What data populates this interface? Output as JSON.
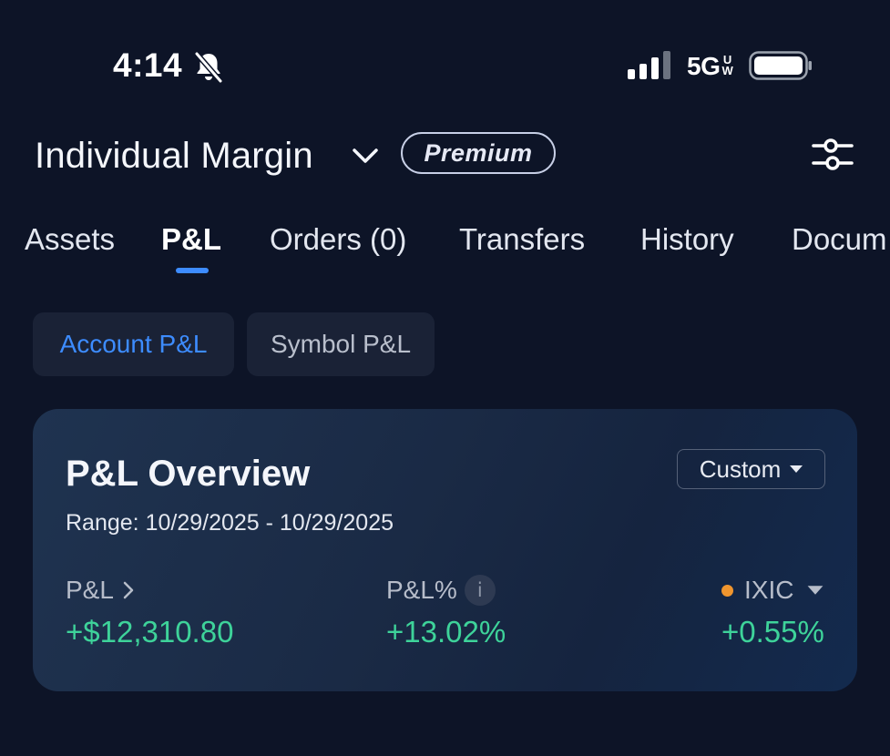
{
  "status_bar": {
    "time": "4:14",
    "network": "5G",
    "network_sup": "UW"
  },
  "header": {
    "account_name": "Individual Margin",
    "badge": "Premium"
  },
  "tabs": [
    {
      "label": "Assets"
    },
    {
      "label": "P&L"
    },
    {
      "label": "Orders (0)"
    },
    {
      "label": "Transfers"
    },
    {
      "label": "History"
    },
    {
      "label": "Docum"
    }
  ],
  "segments": [
    {
      "label": "Account P&L"
    },
    {
      "label": "Symbol P&L"
    }
  ],
  "overview": {
    "title": "P&L Overview",
    "range_select": "Custom",
    "range_text": "Range: 10/29/2025 - 10/29/2025",
    "pnl_label": "P&L",
    "pnl_value": "+$12,310.80",
    "pnl_pct_label": "P&L%",
    "pnl_pct_value": "+13.02%",
    "benchmark_label": "IXIC",
    "benchmark_value": "+0.55%"
  },
  "colors": {
    "background": "#0d1427",
    "accent": "#3d8cff",
    "positive": "#3ed39a",
    "benchmark_dot": "#f0952e"
  }
}
